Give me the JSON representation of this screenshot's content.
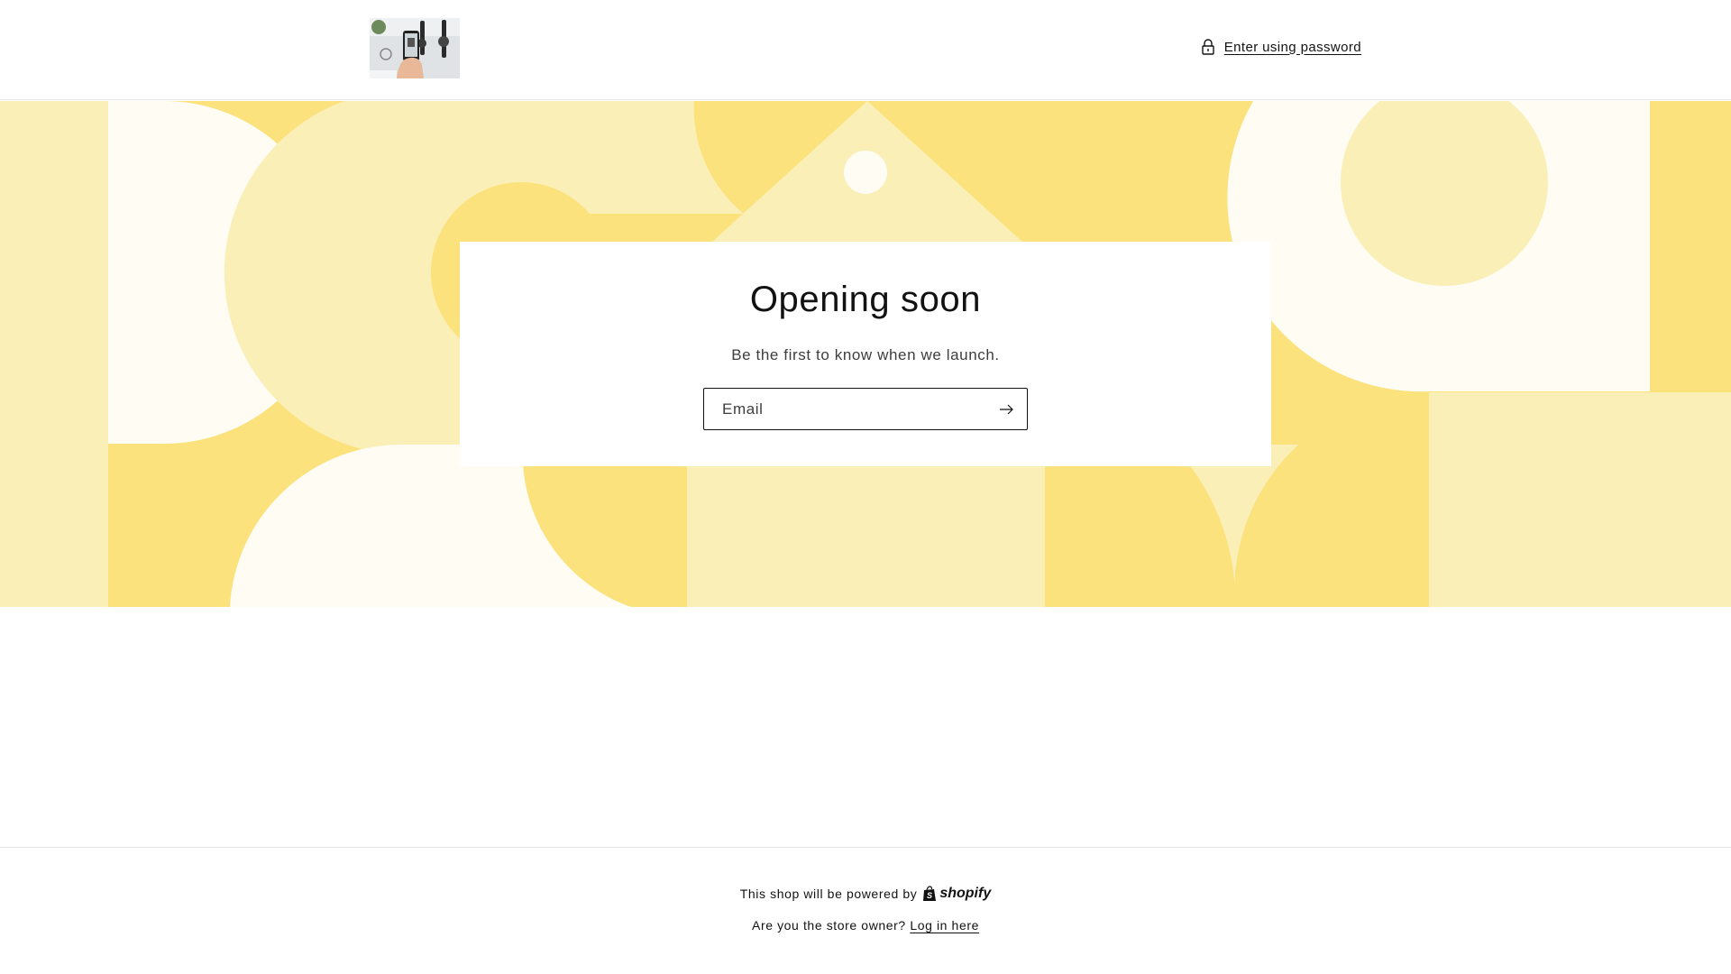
{
  "header": {
    "logo_alt": "store logo",
    "password_link": "Enter using password"
  },
  "colors": {
    "banner_dark": "#fbe27c",
    "banner_mid": "#fbefb8",
    "banner_light": "#fefcf3"
  },
  "main": {
    "title": "Opening soon",
    "subtitle": "Be the first to know when we launch.",
    "email": {
      "placeholder": "Email",
      "value": ""
    }
  },
  "footer": {
    "powered_text": "This shop will be powered by",
    "shopify_label": "shopify",
    "owner_question": "Are you the store owner?",
    "login_link": "Log in here"
  }
}
